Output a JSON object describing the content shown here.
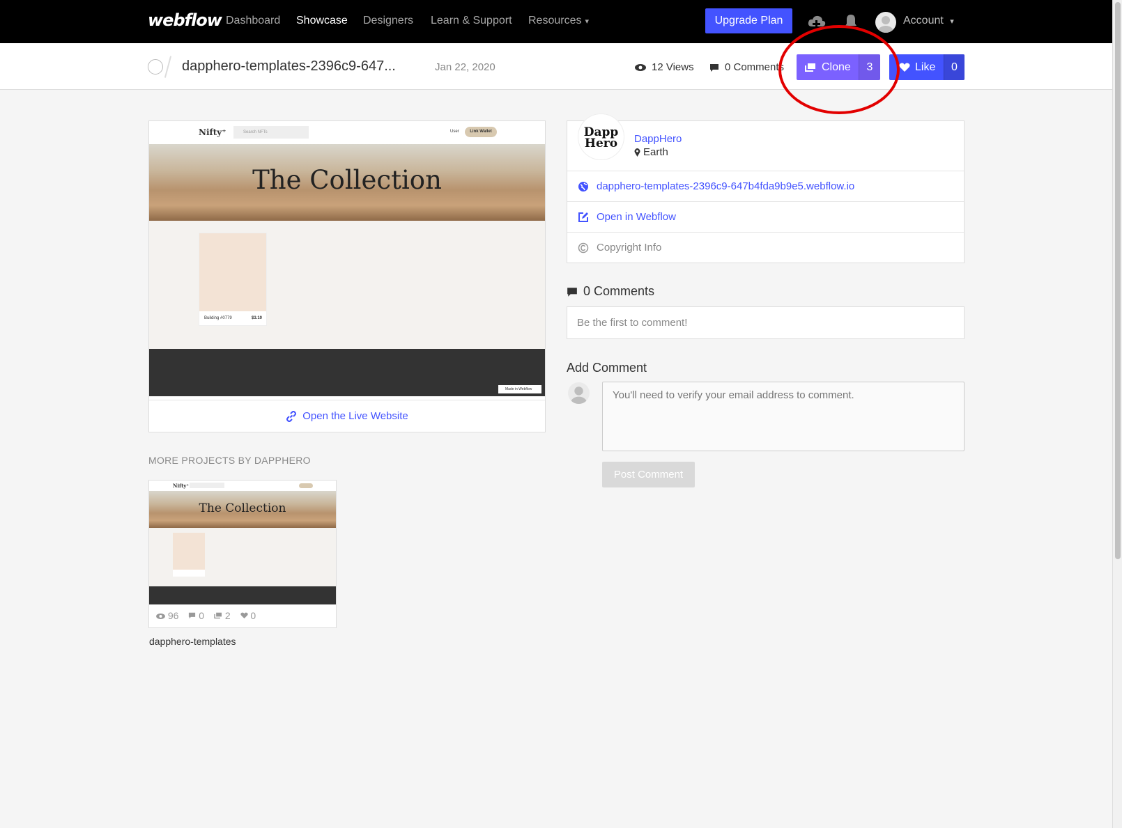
{
  "nav": {
    "logo": "webflow",
    "links": [
      "Dashboard",
      "Showcase",
      "Designers",
      "Learn & Support",
      "Resources"
    ],
    "upgrade": "Upgrade Plan",
    "account": "Account"
  },
  "project": {
    "title": "dapphero-templates-2396c9-647...",
    "date": "Jan 22, 2020",
    "views": "12 Views",
    "comments": "0 Comments",
    "clone_label": "Clone",
    "clone_count": "3",
    "like_label": "Like",
    "like_count": "0"
  },
  "preview": {
    "site_logo": "Nifty⁺",
    "search_placeholder": "Search NFTs",
    "user": "User",
    "wallet": "Link Wallet",
    "hero_title": "The Collection",
    "card_name": "Building #0779",
    "card_price": "$3.10",
    "badge": "Made in Webflow",
    "open_live": "Open the Live Website"
  },
  "more": {
    "title": "MORE PROJECTS BY DAPPHERO",
    "thumb_logo": "Nifty⁺",
    "thumb_title": "The Collection",
    "views": "96",
    "comments": "0",
    "clones": "2",
    "likes": "0",
    "name": "dapphero-templates"
  },
  "author": {
    "avatar_text_1": "Dapp",
    "avatar_text_2": "Hero",
    "name": "DappHero",
    "location": "Earth",
    "url": "dapphero-templates-2396c9-647b4fda9b9e5.webflow.io",
    "open_in": "Open in Webflow",
    "copyright": "Copyright Info"
  },
  "comments": {
    "title": "0 Comments",
    "empty": "Be the first to comment!",
    "add_title": "Add Comment",
    "placeholder": "You'll need to verify your email address to comment.",
    "post": "Post Comment"
  },
  "colors": {
    "accent": "#4353ff",
    "clone": "#7b61ff",
    "annotation": "#e20000"
  }
}
